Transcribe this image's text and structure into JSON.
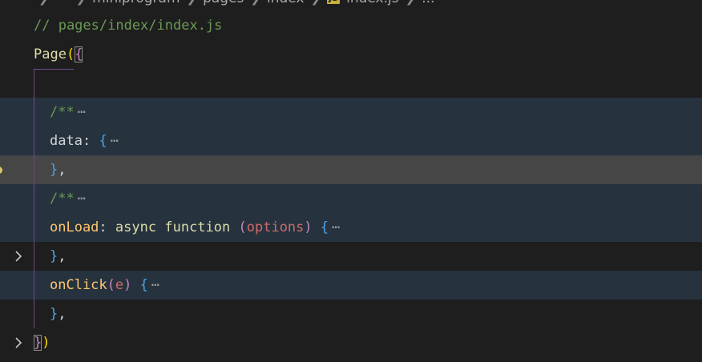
{
  "breadcrumb": {
    "items": [
      "miniprogram",
      "pages",
      "index"
    ],
    "file_badge": "JS",
    "file_name": "index.js",
    "overflow": "..."
  },
  "code": {
    "line1_comment": "// pages/index/index.js",
    "line2_page": "Page",
    "line2_paren": "(",
    "line2_brace": "{",
    "comment_open": "/**",
    "ellipsis": "⋯",
    "data_key": "data",
    "colon": ":",
    "open_brace": "{",
    "close_brace": "}",
    "comma": ",",
    "onload_key": "onLoad",
    "async_kw": "async",
    "function_kw": "function",
    "options_param": "options",
    "onclick_key": "onClick",
    "e_param": "e",
    "paren_open": "(",
    "paren_close": ")"
  },
  "colors": {
    "background": "#1e1e1e",
    "fold_highlight": "#26323e",
    "current_line": "#464646",
    "comment": "#6a9955"
  }
}
